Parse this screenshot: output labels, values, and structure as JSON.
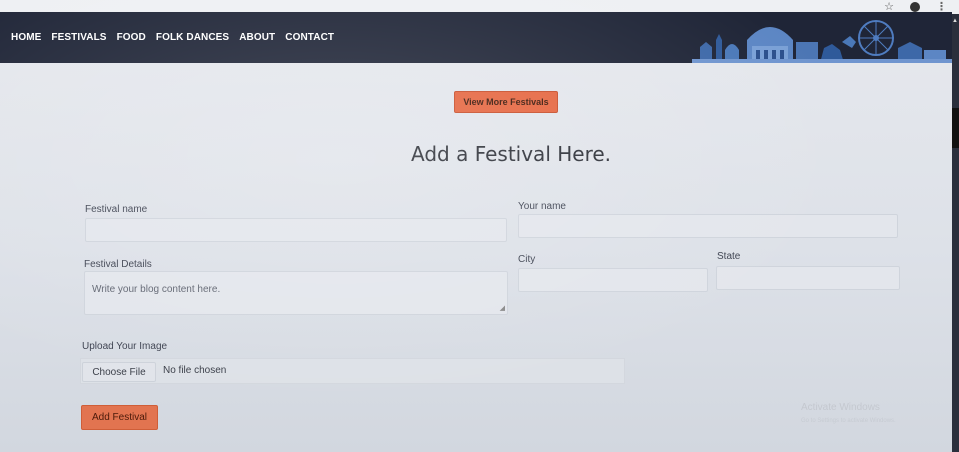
{
  "browser": {
    "icons": [
      "star-icon",
      "profile-icon",
      "menu-icon"
    ]
  },
  "nav": {
    "items": [
      "HOME",
      "FESTIVALS",
      "FOOD",
      "FOLK DANCES",
      "ABOUT",
      "CONTACT"
    ]
  },
  "view_more_label": "View More Festivals",
  "page_title": "Add a Festival Here.",
  "form": {
    "festival_name_label": "Festival name",
    "your_name_label": "Your name",
    "festival_details_label": "Festival Details",
    "festival_details_placeholder": "Write your blog content here.",
    "city_label": "City",
    "state_label": "State",
    "upload_label": "Upload Your Image",
    "choose_file_label": "Choose File",
    "file_status": "No file chosen",
    "submit_label": "Add Festival"
  },
  "watermark": {
    "line1": "Activate Windows",
    "line2": "Go to Settings to activate Windows."
  },
  "colors": {
    "navbar": "#1f2537",
    "accent": "#e5653f",
    "page_bg": "#e2e5eb"
  }
}
